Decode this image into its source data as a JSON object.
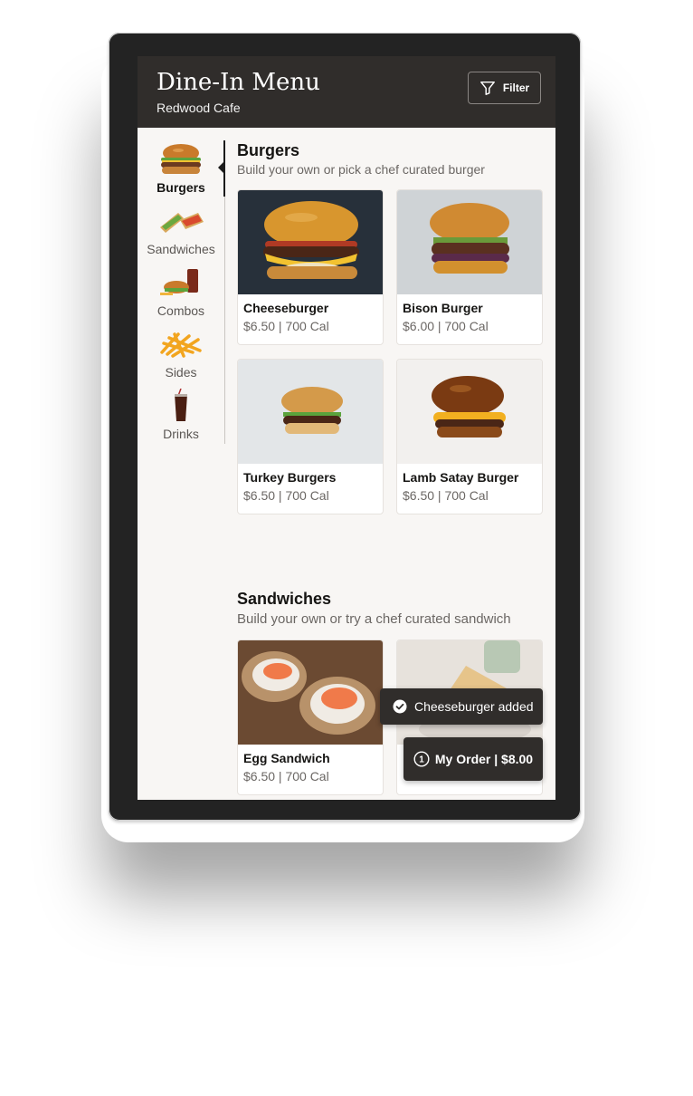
{
  "header": {
    "title": "Dine-In Menu",
    "subtitle": "Redwood Cafe",
    "filter_label": "Filter"
  },
  "sidebar": {
    "items": [
      {
        "label": "Burgers",
        "icon": "burger-icon",
        "active": true
      },
      {
        "label": "Sandwiches",
        "icon": "sandwich-icon",
        "active": false
      },
      {
        "label": "Combos",
        "icon": "combo-icon",
        "active": false
      },
      {
        "label": "Sides",
        "icon": "fries-icon",
        "active": false
      },
      {
        "label": "Drinks",
        "icon": "drink-icon",
        "active": false
      }
    ],
    "help_icon": "help-icon"
  },
  "sections": [
    {
      "title": "Burgers",
      "subtitle": "Build your own or pick a chef curated burger",
      "items": [
        {
          "name": "Cheeseburger",
          "meta": "$6.50 | 700 Cal"
        },
        {
          "name": "Bison Burger",
          "meta": "$6.00 | 700 Cal"
        },
        {
          "name": "Turkey Burgers",
          "meta": "$6.50 | 700 Cal"
        },
        {
          "name": "Lamb Satay Burger",
          "meta": "$6.50 | 700 Cal"
        }
      ]
    },
    {
      "title": "Sandwiches",
      "subtitle": "Build your own or try a chef curated sandwich",
      "items": [
        {
          "name": "Egg Sandwich",
          "meta": "$6.50 | 700 Cal"
        },
        {
          "name": "",
          "meta": ""
        }
      ]
    }
  ],
  "toast": {
    "text": "Cheeseburger added",
    "icon": "check-circle-icon"
  },
  "order": {
    "count": "1",
    "label": "My Order | $8.00"
  },
  "colors": {
    "header_bg": "#302d2b",
    "screen_bg": "#f8f6f4",
    "device": "#232323"
  }
}
